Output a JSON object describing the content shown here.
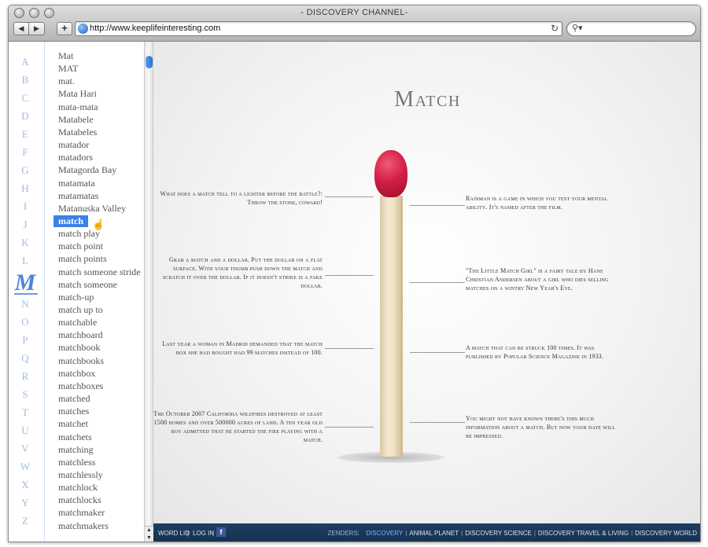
{
  "window": {
    "title": "- DISCOVERY CHANNEL-",
    "url": "http://www.keeplifeinteresting.com"
  },
  "alphabet": {
    "letters": [
      "A",
      "B",
      "C",
      "D",
      "E",
      "F",
      "G",
      "H",
      "I",
      "J",
      "K",
      "L",
      "M",
      "N",
      "O",
      "P",
      "Q",
      "R",
      "S",
      "T",
      "U",
      "V",
      "W",
      "X",
      "Y",
      "Z"
    ],
    "active": "M"
  },
  "words": {
    "items": [
      "Mat",
      "MAT",
      "mat.",
      "Mata Hari",
      "mata-mata",
      "Matabele",
      "Matabeles",
      "matador",
      "matadors",
      "Matagorda Bay",
      "matamata",
      "matamatas",
      "Matanuska Valley",
      "match",
      "match play",
      "match point",
      "match points",
      "match someone stride",
      "match someone",
      "match-up",
      "match up to",
      "matchable",
      "matchboard",
      "matchbook",
      "matchbooks",
      "matchbox",
      "matchboxes",
      "matched",
      "matches",
      "matchet",
      "matchets",
      "matching",
      "matchless",
      "matchlessly",
      "matchlock",
      "matchlocks",
      "matchmaker",
      "matchmakers"
    ],
    "selected": "match"
  },
  "main": {
    "title": "Match",
    "facts_left": [
      "What does a match tell to a lighter before the battle?: Throw the stone, coward!",
      "Grab a match and a dollar. Put the dollar on a flat surface. With your thumb push down the match and scratch it over the dollar. If it doesn't strike is a fake dollar.",
      "Last year a woman in Madrid demanded that the match box she had bought had 99 matches instead of 100.",
      "The October 2007 California wildfires destroyed at least 1500 homes and over 500000 acres of land. A ten year old boy admitted that he started the fire playing with a match."
    ],
    "facts_right": [
      "Rainman is a game in which you test your mental ability. It's named after the film.",
      "\"The Little Match Girl\" is a fairy tale by Hans Christian Andersen about a girl who dies selling matches on a wintry New Year's Eve.",
      "A match that can be struck 100 times. It was published by Popular Science Magazine in 1933.",
      "You might not have known there's this much information about a match. But now your date will be impressed."
    ]
  },
  "footer": {
    "word_lid": "WORD LID",
    "sep": "|",
    "log_in": "LOG IN",
    "fb": "f",
    "zenders_label": "ZENDERS:",
    "channels": [
      "DISCOVERY",
      "ANIMAL PLANET",
      "DISCOVERY SCIENCE",
      "DISCOVERY TRAVEL & LIVING",
      "DISCOVERY WORLD"
    ]
  },
  "icons": {
    "back": "back-arrow-icon",
    "forward": "forward-arrow-icon",
    "add": "plus-icon",
    "globe": "globe-icon",
    "reload": "reload-icon",
    "search": "search-icon",
    "cursor": "hand-cursor-icon"
  }
}
